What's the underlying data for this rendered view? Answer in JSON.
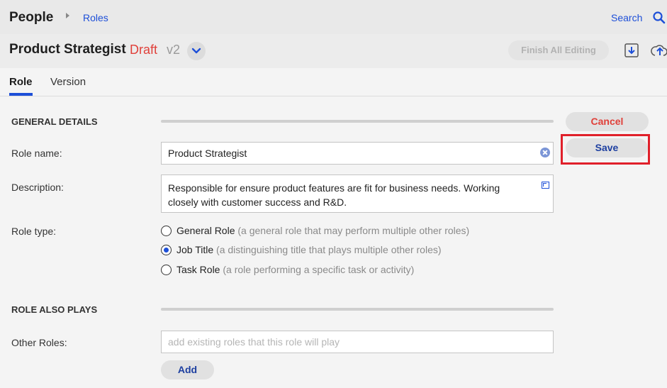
{
  "breadcrumb": {
    "root": "People",
    "current": "Roles"
  },
  "search": {
    "label": "Search"
  },
  "title": {
    "name": "Product Strategist",
    "status": "Draft",
    "version": "v2"
  },
  "toolbar": {
    "finish_label": "Finish All Editing"
  },
  "tabs": [
    {
      "label": "Role",
      "active": true
    },
    {
      "label": "Version",
      "active": false
    }
  ],
  "general": {
    "heading": "GENERAL DETAILS",
    "role_name_label": "Role name:",
    "role_name_value": "Product Strategist",
    "description_label": "Description:",
    "description_value": "Responsible for ensure product features are fit for business needs. Working closely with customer success and R&D.",
    "role_type_label": "Role type:",
    "role_types": [
      {
        "name": "General Role",
        "desc": "(a general role that may perform multiple other roles)",
        "checked": false
      },
      {
        "name": "Job Title",
        "desc": "(a distinguishing title that plays multiple other roles)",
        "checked": true
      },
      {
        "name": "Task Role",
        "desc": "(a role performing a specific task or activity)",
        "checked": false
      }
    ]
  },
  "also_plays": {
    "heading": "ROLE ALSO PLAYS",
    "other_roles_label": "Other Roles:",
    "other_roles_placeholder": "add existing roles that this role will play",
    "add_label": "Add"
  },
  "actions": {
    "cancel_label": "Cancel",
    "save_label": "Save"
  },
  "colors": {
    "accent": "#1d4fd8",
    "draft": "#e0403a",
    "highlight": "#e0202a"
  }
}
